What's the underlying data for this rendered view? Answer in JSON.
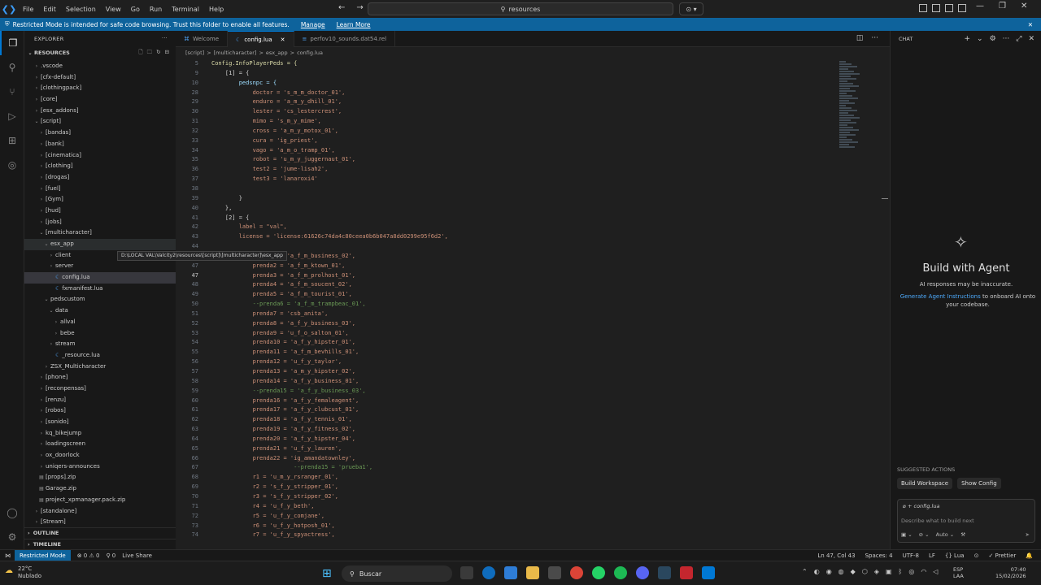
{
  "menu": [
    "File",
    "Edit",
    "Selection",
    "View",
    "Go",
    "Run",
    "Terminal",
    "Help"
  ],
  "search": {
    "text": "resources"
  },
  "banner": {
    "text": "Restricted Mode is intended for safe code browsing. Trust this folder to enable all features.",
    "manage": "Manage",
    "learn": "Learn More"
  },
  "explorer": {
    "title": "EXPLORER",
    "root": "RESOURCES",
    "items": [
      {
        "label": ".vscode",
        "depth": 1,
        "arrow": "›"
      },
      {
        "label": "[cfx-default]",
        "depth": 1,
        "arrow": "›"
      },
      {
        "label": "[clothingpack]",
        "depth": 1,
        "arrow": "›"
      },
      {
        "label": "[core]",
        "depth": 1,
        "arrow": "›"
      },
      {
        "label": "[esx_addons]",
        "depth": 1,
        "arrow": "›"
      },
      {
        "label": "[script]",
        "depth": 1,
        "arrow": "⌄"
      },
      {
        "label": "[bandas]",
        "depth": 2,
        "arrow": "›"
      },
      {
        "label": "[bank]",
        "depth": 2,
        "arrow": "›"
      },
      {
        "label": "[cinematica]",
        "depth": 2,
        "arrow": "›"
      },
      {
        "label": "[clothing]",
        "depth": 2,
        "arrow": "›"
      },
      {
        "label": "[drogas]",
        "depth": 2,
        "arrow": "›"
      },
      {
        "label": "[fuel]",
        "depth": 2,
        "arrow": "›"
      },
      {
        "label": "[Gym]",
        "depth": 2,
        "arrow": "›"
      },
      {
        "label": "[hud]",
        "depth": 2,
        "arrow": "›"
      },
      {
        "label": "[jobs]",
        "depth": 2,
        "arrow": "›"
      },
      {
        "label": "[multicharacter]",
        "depth": 2,
        "arrow": "⌄"
      },
      {
        "label": "esx_app",
        "depth": 3,
        "arrow": "⌄",
        "cls": "hover"
      },
      {
        "label": "client",
        "depth": 4,
        "arrow": "›"
      },
      {
        "label": "server",
        "depth": 4,
        "arrow": "›"
      },
      {
        "label": "config.lua",
        "depth": 4,
        "arrow": "",
        "lua": true,
        "cls": "sel"
      },
      {
        "label": "fxmanifest.lua",
        "depth": 4,
        "arrow": "",
        "lua": true
      },
      {
        "label": "pedscustom",
        "depth": 3,
        "arrow": "⌄"
      },
      {
        "label": "data",
        "depth": 4,
        "arrow": "⌄"
      },
      {
        "label": "allval",
        "depth": 5,
        "arrow": "›"
      },
      {
        "label": "bebe",
        "depth": 5,
        "arrow": "›"
      },
      {
        "label": "stream",
        "depth": 4,
        "arrow": "›"
      },
      {
        "label": "_resource.lua",
        "depth": 4,
        "arrow": "",
        "lua": true
      },
      {
        "label": "ZSX_Multicharacter",
        "depth": 3,
        "arrow": "›"
      },
      {
        "label": "[phone]",
        "depth": 2,
        "arrow": "›"
      },
      {
        "label": "[reconpensas]",
        "depth": 2,
        "arrow": "›"
      },
      {
        "label": "[renzu]",
        "depth": 2,
        "arrow": "›"
      },
      {
        "label": "[robos]",
        "depth": 2,
        "arrow": "›"
      },
      {
        "label": "[sonido]",
        "depth": 2,
        "arrow": "›"
      },
      {
        "label": "kq_bikejump",
        "depth": 2,
        "arrow": "›"
      },
      {
        "label": "loadingscreen",
        "depth": 2,
        "arrow": "›"
      },
      {
        "label": "ox_doorlock",
        "depth": 2,
        "arrow": "›"
      },
      {
        "label": "uniqers-announces",
        "depth": 2,
        "arrow": "›"
      },
      {
        "label": "[props].zip",
        "depth": 2,
        "arrow": "▤"
      },
      {
        "label": "Garage.zip",
        "depth": 2,
        "arrow": "▤"
      },
      {
        "label": "project_xpmanager.pack.zip",
        "depth": 2,
        "arrow": "▤"
      },
      {
        "label": "[standalone]",
        "depth": 1,
        "arrow": "›"
      },
      {
        "label": "[Stream]",
        "depth": 1,
        "arrow": "›"
      }
    ],
    "outline": "OUTLINE",
    "timeline": "TIMELINE",
    "tooltip": "D:\\LOCAL VAL\\Valcity2\\resources\\[script]\\[multicharacter]\\esx_app"
  },
  "tabs": [
    {
      "label": "Welcome",
      "icon": "⌘",
      "active": false
    },
    {
      "label": "config.lua",
      "icon": "☾",
      "active": true,
      "close": "✕"
    },
    {
      "label": "perfov10_sounds.dat54.rel",
      "icon": "≡",
      "active": false
    }
  ],
  "breadcrumb": [
    "[script]",
    ">",
    "[multicharacter]",
    ">",
    "esx_app",
    ">",
    "config.lua"
  ],
  "code": [
    {
      "n": "5",
      "t": "Config.InfoPlayerPeds = {",
      "st": "fn"
    },
    {
      "n": "9",
      "t": "    [1] = {",
      "st": "k"
    },
    {
      "n": "10",
      "t": "        pedsnpc = {",
      "st": ""
    },
    {
      "n": "28",
      "t": "            doctor = 's_m_m_doctor_01',",
      "st": "kv"
    },
    {
      "n": "29",
      "t": "            enduro = 'a_m_y_dhill_01',",
      "st": "kv"
    },
    {
      "n": "30",
      "t": "            lester = 'cs_lestercrest',",
      "st": "kv"
    },
    {
      "n": "31",
      "t": "            mimo = 's_m_y_mime',",
      "st": "kv"
    },
    {
      "n": "32",
      "t": "            cross = 'a_m_y_motox_01',",
      "st": "kv"
    },
    {
      "n": "33",
      "t": "            cura = 'ig_priest',",
      "st": "kv"
    },
    {
      "n": "34",
      "t": "            vago = 'a_m_o_tramp_01',",
      "st": "kv"
    },
    {
      "n": "35",
      "t": "            robot = 'u_m_y_juggernaut_01',",
      "st": "kv"
    },
    {
      "n": "36",
      "t": "            test2 = 'jume-lisah2',",
      "st": "kv"
    },
    {
      "n": "37",
      "t": "            test3 = 'lanaroxi4'",
      "st": "kv"
    },
    {
      "n": "38",
      "t": "",
      "st": ""
    },
    {
      "n": "39",
      "t": "        }",
      "st": "k"
    },
    {
      "n": "40",
      "t": "    },",
      "st": "k"
    },
    {
      "n": "41",
      "t": "    [2] = {",
      "st": "k"
    },
    {
      "n": "42",
      "t": "        label = \"val\",",
      "st": "kv"
    },
    {
      "n": "43",
      "t": "        license = 'license:61626c74da4c80ceea0b6b047a8dd0299e95f6d2',",
      "st": "kv"
    },
    {
      "n": "44",
      "t": "        ",
      "st": ""
    },
    {
      "n": "46",
      "t": "            prenda1 = 'a_f_m_business_02',",
      "st": "kv"
    },
    {
      "n": "47",
      "t": "            prenda2 = 'a_f_m_ktown_01',",
      "st": "kv"
    },
    {
      "n": "47",
      "t": "            prenda3 = 'a_f_m_prolhost_01',",
      "st": "kv",
      "cur": true
    },
    {
      "n": "48",
      "t": "            prenda4 = 'a_f_m_soucent_02',",
      "st": "kv"
    },
    {
      "n": "49",
      "t": "            prenda5 = 'a_f_m_tourist_01',",
      "st": "kv"
    },
    {
      "n": "50",
      "t": "            --prenda6 = 'a_f_m_trampbeac_01',",
      "st": "c"
    },
    {
      "n": "51",
      "t": "            prenda7 = 'csb_anita',",
      "st": "kv"
    },
    {
      "n": "52",
      "t": "            prenda8 = 'a_f_y_business_03',",
      "st": "kv"
    },
    {
      "n": "53",
      "t": "            prenda9 = 'u_f_o_salton_01',",
      "st": "kv"
    },
    {
      "n": "54",
      "t": "            prenda10 = 'a_f_y_hipster_01',",
      "st": "kv"
    },
    {
      "n": "55",
      "t": "            prenda11 = 'a_f_m_bevhills_01',",
      "st": "kv"
    },
    {
      "n": "56",
      "t": "            prenda12 = 'u_f_y_taylor',",
      "st": "kv"
    },
    {
      "n": "57",
      "t": "            prenda13 = 'a_m_y_hipster_02',",
      "st": "kv"
    },
    {
      "n": "58",
      "t": "            prenda14 = 'a_f_y_business_01',",
      "st": "kv"
    },
    {
      "n": "59",
      "t": "            --prenda15 = 'a_f_y_business_03',",
      "st": "c"
    },
    {
      "n": "60",
      "t": "            prenda16 = 'a_f_y_femaleagent',",
      "st": "kv"
    },
    {
      "n": "61",
      "t": "            prenda17 = 'a_f_y_clubcust_01',",
      "st": "kv"
    },
    {
      "n": "62",
      "t": "            prenda18 = 'a_f_y_tennis_01',",
      "st": "kv"
    },
    {
      "n": "63",
      "t": "            prenda19 = 'a_f_y_fitness_02',",
      "st": "kv"
    },
    {
      "n": "64",
      "t": "            prenda20 = 'a_f_y_hipster_04',",
      "st": "kv"
    },
    {
      "n": "65",
      "t": "            prenda21 = 'u_f_y_lauren',",
      "st": "kv"
    },
    {
      "n": "66",
      "t": "            prenda22 = 'ig_amandatownley',",
      "st": "kv"
    },
    {
      "n": "67",
      "t": "                        --prenda15 = 'prueba1',",
      "st": "c"
    },
    {
      "n": "68",
      "t": "            r1 = 'u_m_y_rsranger_01',",
      "st": "kv"
    },
    {
      "n": "69",
      "t": "            r2 = 's_f_y_stripper_01',",
      "st": "kv"
    },
    {
      "n": "70",
      "t": "            r3 = 's_f_y_stripper_02',",
      "st": "kv"
    },
    {
      "n": "71",
      "t": "            r4 = 'u_f_y_beth',",
      "st": "kv"
    },
    {
      "n": "72",
      "t": "            r5 = 'u_f_y_comjane',",
      "st": "kv"
    },
    {
      "n": "73",
      "t": "            r6 = 'u_f_y_hotposh_01',",
      "st": "kv"
    },
    {
      "n": "74",
      "t": "            r7 = 'u_f_y_spyactress',",
      "st": "kv"
    }
  ],
  "chat": {
    "title": "CHAT",
    "heading": "Build with Agent",
    "sub": "AI responses may be inaccurate.",
    "link": "Generate Agent Instructions",
    "desc": "to onboard AI onto your codebase.",
    "suggested": "SUGGESTED ACTIONS",
    "actions": [
      "Build Workspace",
      "Show Config"
    ],
    "context": "config.lua",
    "placeholder": "Describe what to build next",
    "mode": "Auto"
  },
  "status": {
    "restricted": "Restricted Mode",
    "problems": "⊗ 0 ⚠ 0",
    "ports": "⚲ 0",
    "live": "Live Share",
    "position": "Ln 47, Col 43",
    "spaces": "Spaces: 4",
    "encoding": "UTF-8",
    "eol": "LF",
    "lang": "{} Lua",
    "prettier": "✓ Prettier"
  },
  "taskbar": {
    "temp": "22°C",
    "weather": "Nublado",
    "search": "Buscar",
    "lang1": "ESP",
    "lang2": "LAA",
    "time": "07:40",
    "date": "15/02/2026"
  },
  "colors": {
    "accent": "#0078d4",
    "banner": "#0e639c",
    "restricted": "#0e639c",
    "string": "#ce9178",
    "comment": "#6a9955",
    "ident": "#9cdcfe"
  }
}
